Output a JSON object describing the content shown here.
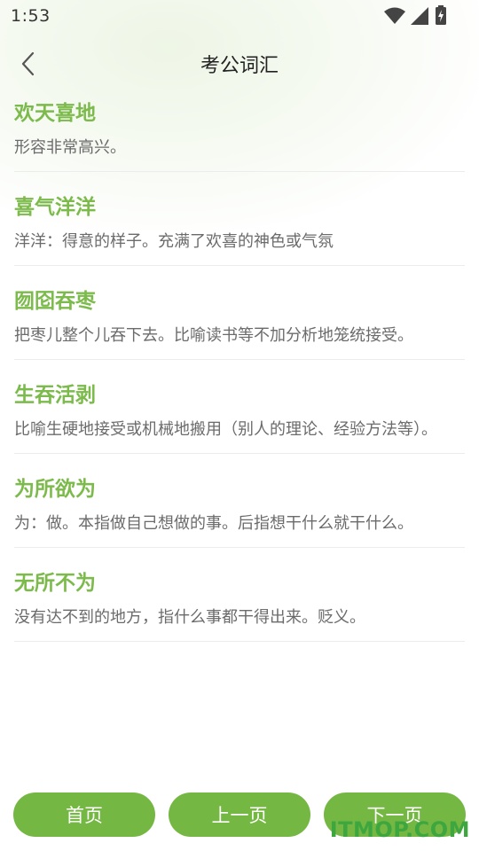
{
  "status": {
    "time": "1:53",
    "icons": [
      "wifi-icon",
      "signal-icon",
      "battery-icon"
    ]
  },
  "nav": {
    "back_icon": "chevron-left-icon",
    "title": "考公词汇"
  },
  "items": [
    {
      "term": "欢天喜地",
      "definition": "形容非常高兴。"
    },
    {
      "term": "喜气洋洋",
      "definition": "洋洋：得意的样子。充满了欢喜的神色或气氛"
    },
    {
      "term": "囫囵吞枣",
      "definition": "把枣儿整个儿吞下去。比喻读书等不加分析地笼统接受。"
    },
    {
      "term": "生吞活剥",
      "definition": "比喻生硬地接受或机械地搬用（别人的理论、经验方法等）。"
    },
    {
      "term": "为所欲为",
      "definition": "为：做。本指做自己想做的事。后指想干什么就干什么。"
    },
    {
      "term": "无所不为",
      "definition": "没有达不到的地方，指什么事都干得出来。贬义。"
    }
  ],
  "footer": {
    "first_label": "首页",
    "prev_label": "上一页",
    "next_label": "下一页"
  },
  "watermark": "ITMOP.COM",
  "colors": {
    "accent": "#74b843",
    "term_text": "#7cba4b",
    "definition_text": "#6b6b6b"
  }
}
